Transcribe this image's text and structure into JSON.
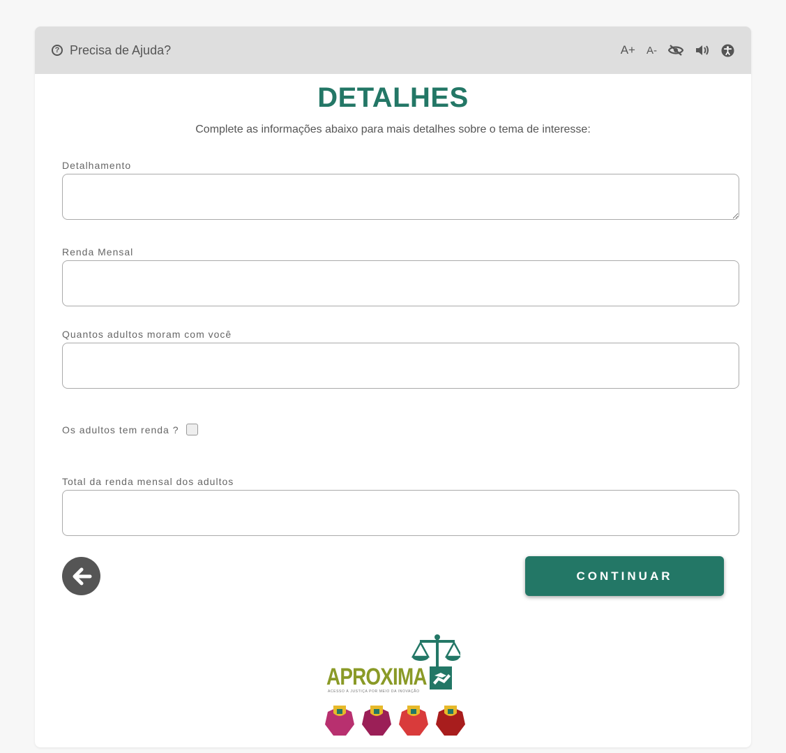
{
  "topbar": {
    "help_icon": "question-circle-icon",
    "help_label": "Precisa de Ajuda?",
    "font_increase": "A+",
    "font_decrease": "A-",
    "contrast_icon": "eye-slash-icon",
    "audio_icon": "volume-icon",
    "accessibility_icon": "accessibility-icon"
  },
  "header": {
    "title": "DETALHES",
    "subtitle": "Complete as informações abaixo para mais detalhes sobre o tema de interesse:"
  },
  "form": {
    "detalhamento": {
      "label": "Detalhamento",
      "value": ""
    },
    "renda_mensal": {
      "label": "Renda Mensal",
      "value": ""
    },
    "adultos": {
      "label": "Quantos adultos moram com você",
      "value": ""
    },
    "adultos_renda": {
      "label": "Os adultos tem renda ?",
      "checked": false
    },
    "total_renda": {
      "label": "Total da renda mensal dos adultos",
      "value": ""
    }
  },
  "actions": {
    "back_icon": "arrow-left-icon",
    "continue_label": "CONTINUAR"
  },
  "footer": {
    "logo_text": "APROXIMA",
    "logo_tagline": "ACESSO À JUSTIÇA POR MEIO DA INOVAÇÃO",
    "badge_colors": [
      "#b8306f",
      "#9b1f57",
      "#d93b3b",
      "#a81d1d"
    ]
  },
  "colors": {
    "accent": "#237766",
    "logo_green": "#8a9a27",
    "topbar_bg": "#dedede",
    "page_bg": "#f7f7f7"
  }
}
